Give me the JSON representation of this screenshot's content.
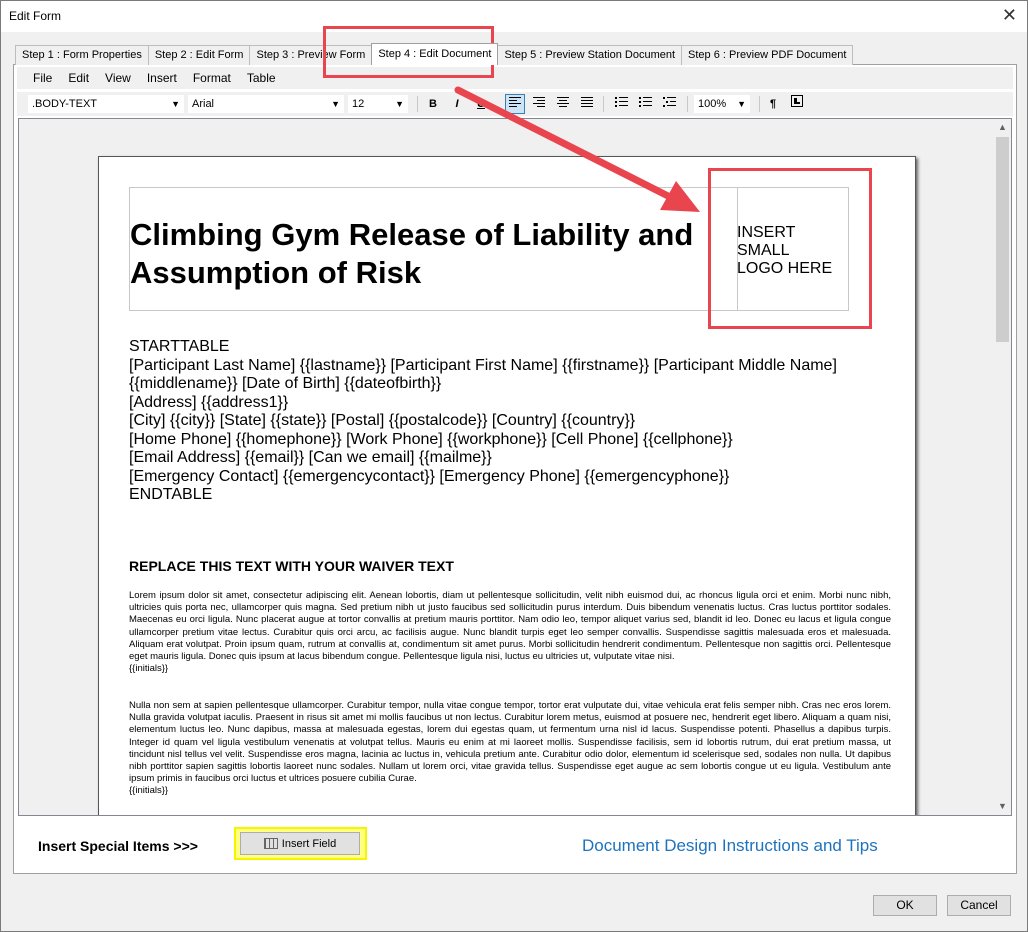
{
  "window": {
    "title": "Edit Form",
    "close_glyph": "✕"
  },
  "tabs": [
    {
      "label": "Step 1 : Form Properties",
      "active": false
    },
    {
      "label": "Step 2 : Edit Form",
      "active": false
    },
    {
      "label": "Step 3 : Preview Form",
      "active": false
    },
    {
      "label": "Step 4 : Edit Document",
      "active": true
    },
    {
      "label": "Step 5 : Preview Station Document",
      "active": false
    },
    {
      "label": "Step 6 : Preview PDF Document",
      "active": false
    }
  ],
  "menu": [
    "File",
    "Edit",
    "View",
    "Insert",
    "Format",
    "Table"
  ],
  "toolbar": {
    "style": ".BODY-TEXT",
    "font": "Arial",
    "size": "12",
    "zoom": "100%",
    "bold": "B",
    "italic": "I",
    "underline": "U",
    "pilcrow": "¶"
  },
  "document": {
    "title_line1": "Climbing Gym Release of Liability and",
    "title_line2": "Assumption of Risk",
    "logo_line1": "INSERT",
    "logo_line2": "SMALL",
    "logo_line3": "LOGO HERE",
    "fields": [
      "STARTTABLE",
      "[Participant Last Name] {{lastname}} [Participant First Name] {{firstname}} [Participant Middle Name]",
      "{{middlename}} [Date of Birth] {{dateofbirth}}",
      "[Address] {{address1}}",
      "[City] {{city}} [State] {{state}} [Postal] {{postalcode}} [Country] {{country}}",
      "[Home Phone] {{homephone}} [Work Phone] {{workphone}} [Cell Phone] {{cellphone}}",
      "[Email Address] {{email}} [Can we email] {{mailme}}",
      "[Emergency Contact] {{emergencycontact}} [Emergency Phone] {{emergencyphone}}",
      "ENDTABLE"
    ],
    "waiver_heading": "REPLACE THIS TEXT WITH YOUR WAIVER TEXT",
    "paragraph1": "Lorem ipsum dolor sit amet, consectetur adipiscing elit. Aenean lobortis, diam ut pellentesque sollicitudin, velit nibh euismod dui, ac rhoncus ligula orci et enim. Morbi nunc nibh, ultricies quis porta nec, ullamcorper quis magna. Sed pretium nibh ut justo faucibus sed sollicitudin purus interdum. Duis bibendum venenatis luctus. Cras luctus porttitor sodales. Maecenas eu orci ligula. Nunc placerat augue at tortor convallis at pretium mauris porttitor. Nam odio leo, tempor aliquet varius sed, blandit id leo. Donec eu lacus et ligula congue ullamcorper pretium vitae lectus. Curabitur quis orci arcu, ac facilisis augue. Nunc blandit turpis eget leo semper convallis. Suspendisse sagittis malesuada eros et malesuada. Aliquam erat volutpat. Proin ipsum quam, rutrum at convallis at, condimentum sit amet purus. Morbi sollicitudin hendrerit condimentum. Pellentesque non sagittis orci. Pellentesque eget mauris ligula. Donec quis ipsum at lacus bibendum congue. Pellentesque ligula nisi, luctus eu ultricies ut, vulputate vitae nisi.",
    "initials1": "{{initials}}",
    "paragraph2": "Nulla non sem at sapien pellentesque ullamcorper. Curabitur tempor, nulla vitae congue tempor, tortor erat vulputate dui, vitae vehicula erat felis semper nibh. Cras nec eros lorem. Nulla gravida volutpat iaculis. Praesent in risus sit amet mi mollis faucibus ut non lectus. Curabitur lorem metus, euismod at posuere nec, hendrerit eget libero. Aliquam a quam nisi, elementum luctus leo. Nunc dapibus, massa at malesuada egestas, lorem dui egestas quam, ut fermentum urna nisl id lacus. Suspendisse potenti. Phasellus a dapibus turpis. Integer id quam vel ligula vestibulum venenatis at volutpat tellus. Mauris eu enim at mi laoreet mollis. Suspendisse facilisis, sem id lobortis rutrum, dui erat pretium massa, ut tincidunt nisl tellus vel velit. Suspendisse eros magna, lacinia ac luctus in, vehicula pretium ante. Curabitur odio dolor, elementum id scelerisque sed, sodales non nulla. Ut dapibus nibh porttitor sapien sagittis lobortis laoreet nunc sodales. Nullam ut lorem orci, vitae gravida tellus. Suspendisse eget augue ac sem lobortis congue ut eu ligula. Vestibulum ante ipsum primis in faucibus orci luctus et ultrices posuere cubilia Curae.",
    "initials2": "{{initials}}"
  },
  "bottom": {
    "insert_label": "Insert Special Items >>>",
    "insert_field_button": "Insert Field",
    "instructions_link": "Document Design Instructions and Tips",
    "ok_button": "OK",
    "cancel_button": "Cancel"
  },
  "colors": {
    "annotation_red": "#e8454f",
    "link_blue": "#1e73be",
    "highlight_yellow": "#ffff80"
  }
}
